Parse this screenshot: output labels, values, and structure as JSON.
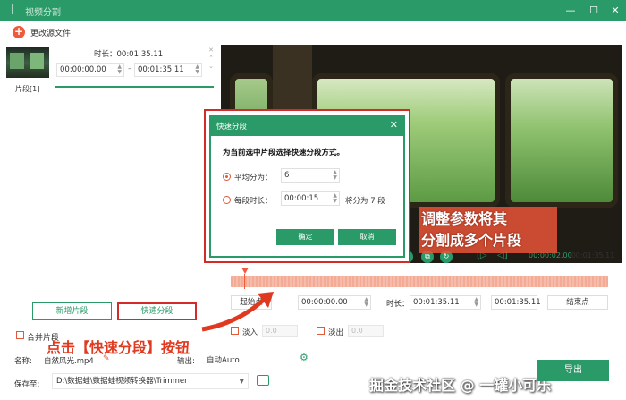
{
  "window": {
    "title": "视频分割",
    "minimize": "—",
    "maximize": "☐",
    "close": "✕"
  },
  "toolbar": {
    "plus": "+",
    "change_source": "更改源文件"
  },
  "clip": {
    "label": "片段[1]",
    "duration": "时长：00:01:35.11",
    "start": "00:00:00.00",
    "end": "00:01:35.11",
    "dash": "–"
  },
  "left_buttons": {
    "new_segment": "新增片段",
    "quick_split": "快速分段"
  },
  "merge": {
    "label": "合并片段"
  },
  "annotations": {
    "left": "点击【快速分段】按钮",
    "right_line1": "调整参数将其",
    "right_line2": "分割成多个片段"
  },
  "output": {
    "name_label": "名称:",
    "name_value": "自然风光.mp4",
    "format_label": "输出:",
    "format_value": "自动Auto",
    "save_label": "保存至:",
    "save_path": "D:\\数据蛙\\数据蛙视频转换器\\Trimmer",
    "export": "导出"
  },
  "watermark": "掘金技术社区 @ 一罐小可乐",
  "player": {
    "time_current": "00:00:02.00",
    "time_total": "/00:01:35.11"
  },
  "segment": {
    "start_btn": "起始点",
    "start_val": "00:00:00.00",
    "duration_label": "时长：",
    "duration_val": "00:01:35.11",
    "end_val": "00:01:35.11",
    "end_btn": "结束点",
    "fade_in": "淡入",
    "fade_in_val": "0.0",
    "fade_out": "淡出",
    "fade_out_val": "0.0"
  },
  "dialog": {
    "title": "快速分段",
    "close": "✕",
    "prompt": "为当前选中片段选择快速分段方式。",
    "opt_even_label": "平均分为：",
    "opt_even_value": "6",
    "opt_len_label": "每段时长：",
    "opt_len_value": "00:00:15",
    "opt_len_note": "将分为 7 段",
    "ok": "确定",
    "cancel": "取消"
  },
  "colors": {
    "accent": "#2a9a68",
    "warning": "#e05a3a",
    "highlight": "#d32a2a"
  }
}
